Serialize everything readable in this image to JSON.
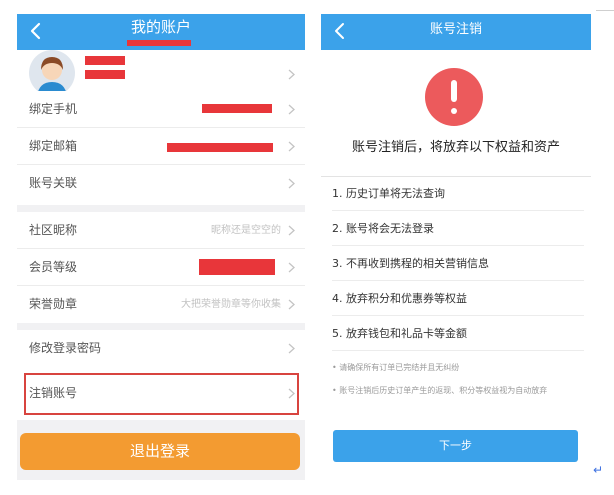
{
  "left": {
    "title": "我的账户",
    "rows": [
      {
        "label": "绑定手机",
        "value": ""
      },
      {
        "label": "绑定邮箱",
        "value": ""
      },
      {
        "label": "账号关联",
        "value": ""
      },
      {
        "label": "社区昵称",
        "value": "昵称还是空空的"
      },
      {
        "label": "会员等级",
        "value": ""
      },
      {
        "label": "荣誉勋章",
        "value": "大把荣誉勋章等你收集"
      },
      {
        "label": "修改登录密码",
        "value": ""
      },
      {
        "label": "注销账号",
        "value": ""
      }
    ],
    "logout_label": "退出登录"
  },
  "right": {
    "title": "账号注销",
    "headline": "账号注销后，将放弃以下权益和资产",
    "items": [
      "1. 历史订单将无法查询",
      "2. 账号将会无法登录",
      "3. 不再收到携程的相关营销信息",
      "4. 放弃积分和优惠券等权益",
      "5. 放弃钱包和礼品卡等金额"
    ],
    "notes": [
      "• 请确保所有订单已完结并且无纠纷",
      "• 账号注销后历史订单产生的返现、积分等权益视为自动放弃"
    ],
    "next_label": "下一步"
  },
  "colors": {
    "header_blue": "#3ba2ea",
    "logout_orange": "#f39b31",
    "alert_red": "#ec5a5c",
    "redaction_red": "#e8363a"
  },
  "icons": {
    "back": "chevron-left-icon",
    "chevron": "chevron-right-icon",
    "alert": "exclamation-icon",
    "avatar": "avatar-icon"
  }
}
